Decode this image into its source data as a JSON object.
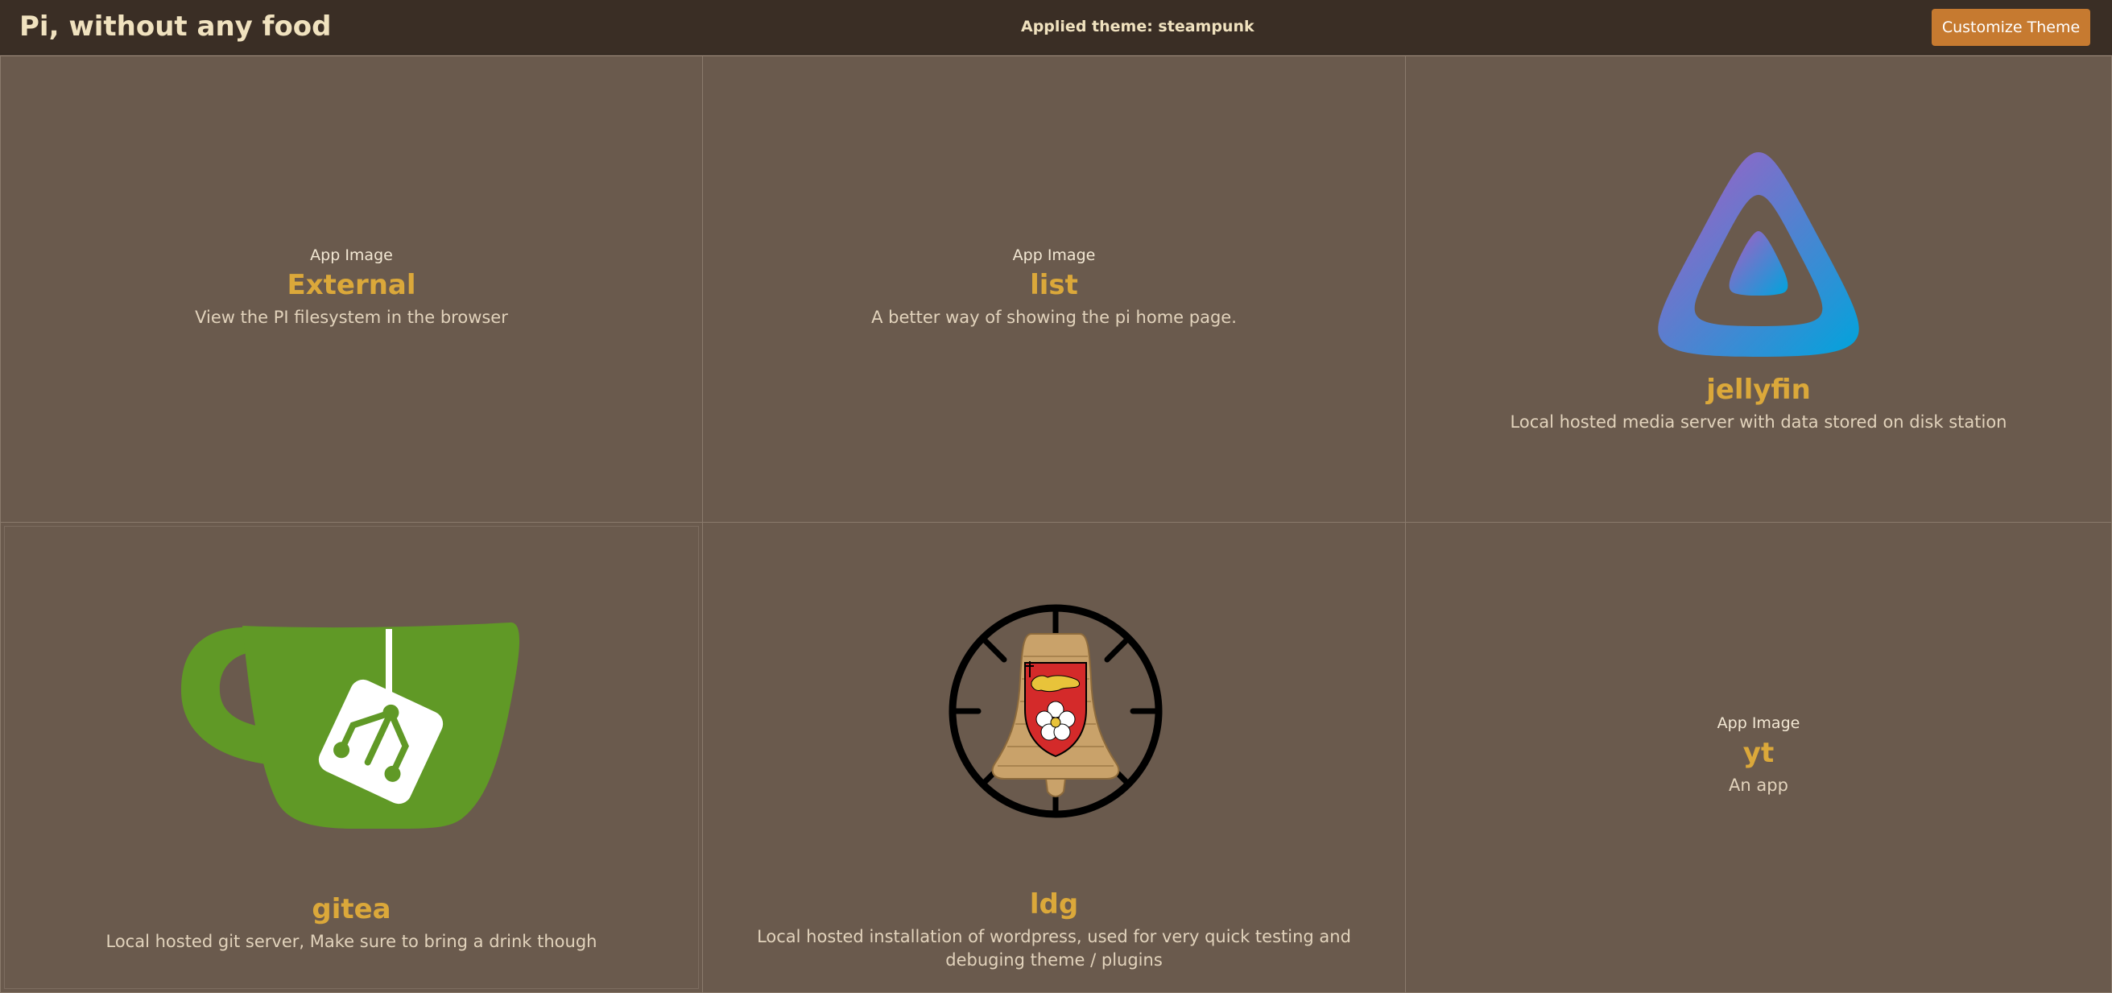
{
  "header": {
    "title": "Pi, without any food",
    "theme_label": "Applied theme: steampunk",
    "customize_label": "Customize Theme"
  },
  "colors": {
    "header_bg": "#3a2e25",
    "page_bg": "#6a5a4d",
    "accent": "#c67a30",
    "app_name": "#dba83a"
  },
  "apps": [
    {
      "name": "External",
      "image_alt": "App Image",
      "description": "View the PI filesystem in the browser",
      "icon": null
    },
    {
      "name": "list",
      "image_alt": "App Image",
      "description": "A better way of showing the pi home page.",
      "icon": null
    },
    {
      "name": "jellyfin",
      "description": "Local hosted media server with data stored on disk station",
      "icon": "jellyfin-logo-icon"
    },
    {
      "name": "gitea",
      "description": "Local hosted git server, Make sure to bring a drink though",
      "icon": "gitea-teacup-logo-icon"
    },
    {
      "name": "ldg",
      "description": "Local hosted installation of wordpress, used for very quick testing and debuging theme / plugins",
      "icon": "bell-crest-logo-icon"
    },
    {
      "name": "yt",
      "image_alt": "App Image",
      "description": "An app",
      "icon": null
    }
  ]
}
